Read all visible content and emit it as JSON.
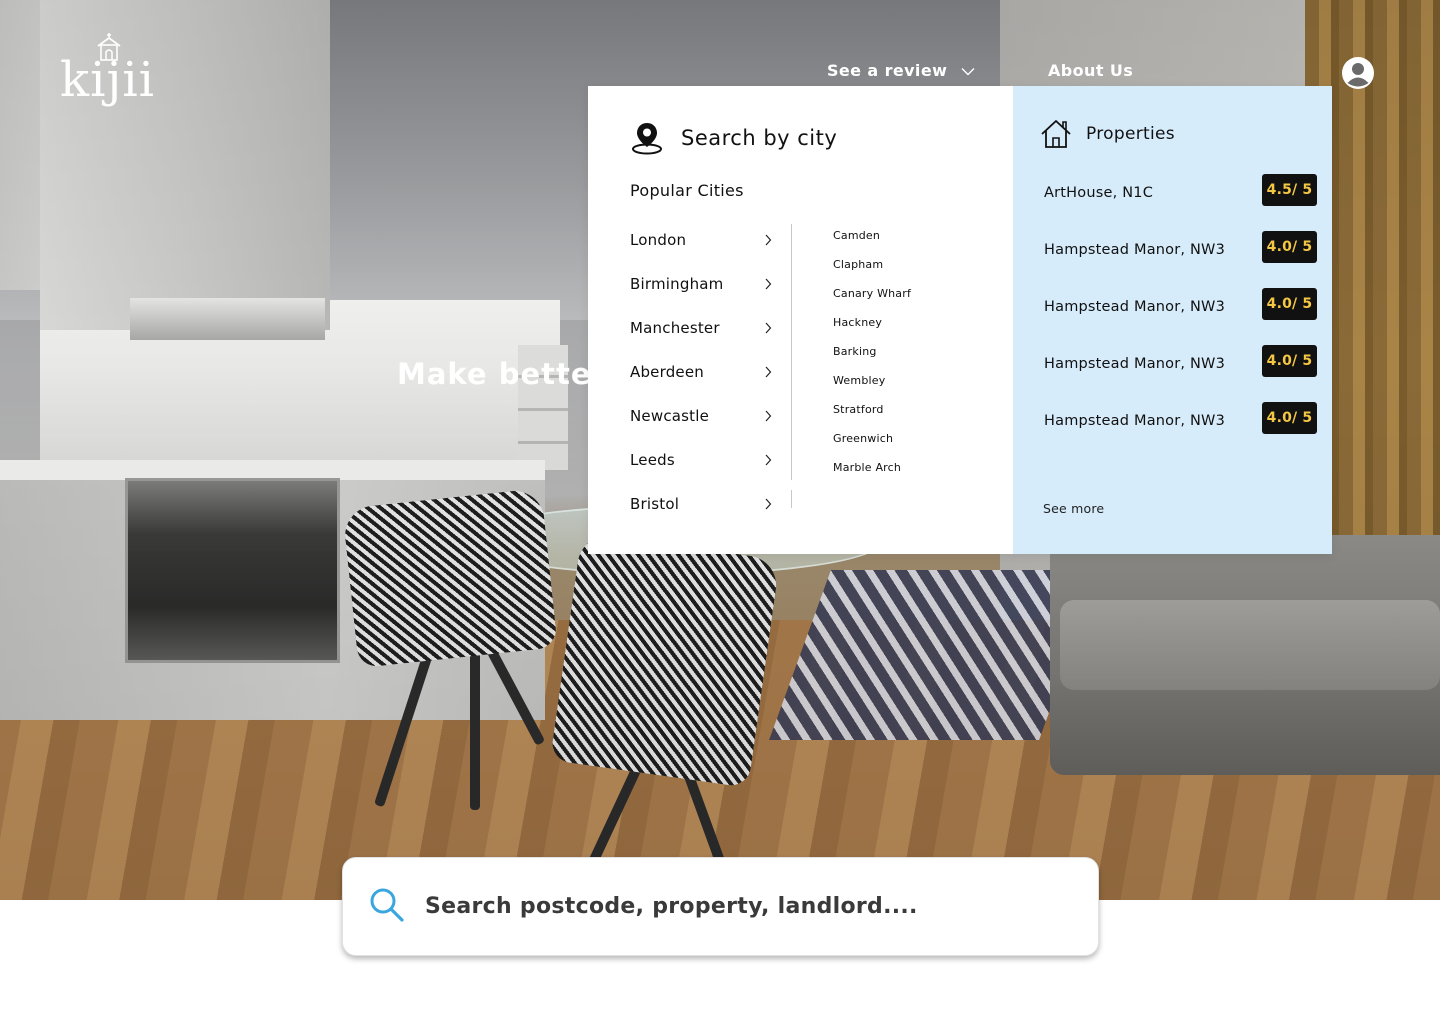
{
  "brand": {
    "name": "kijii",
    "logo_icon": "house-icon"
  },
  "nav": {
    "review_label": "See a review",
    "review_icon": "chevron-down-icon",
    "about_label": "About Us",
    "user_icon": "user-circle-icon"
  },
  "hero": {
    "headline": "Make better"
  },
  "dropdown": {
    "city": {
      "icon": "location-pin-icon",
      "title": "Search by city",
      "popular_label": "Popular Cities",
      "cities": [
        "London",
        "Birmingham",
        "Manchester",
        "Aberdeen",
        "Newcastle",
        "Leeds",
        "Bristol"
      ],
      "areas": [
        "Camden",
        "Clapham",
        "Canary Wharf",
        "Hackney",
        "Barking",
        "Wembley",
        "Stratford",
        "Greenwich",
        "Marble Arch"
      ]
    },
    "properties": {
      "icon": "house-outline-icon",
      "title": "Properties",
      "items": [
        {
          "name": "ArtHouse, N1C",
          "rating": "4.5/ 5"
        },
        {
          "name": "Hampstead Manor, NW3",
          "rating": "4.0/ 5"
        },
        {
          "name": "Hampstead Manor, NW3",
          "rating": "4.0/ 5"
        },
        {
          "name": "Hampstead Manor, NW3",
          "rating": "4.0/ 5"
        },
        {
          "name": "Hampstead Manor, NW3",
          "rating": "4.0/ 5"
        }
      ],
      "see_more": "See more"
    }
  },
  "search": {
    "icon": "search-icon",
    "placeholder": "Search postcode, property, landlord...."
  },
  "colors": {
    "panel_blue": "#d7ecfb",
    "rating_bg": "#111111",
    "rating_text": "#f3c744",
    "search_icon": "#3aa6e0"
  }
}
